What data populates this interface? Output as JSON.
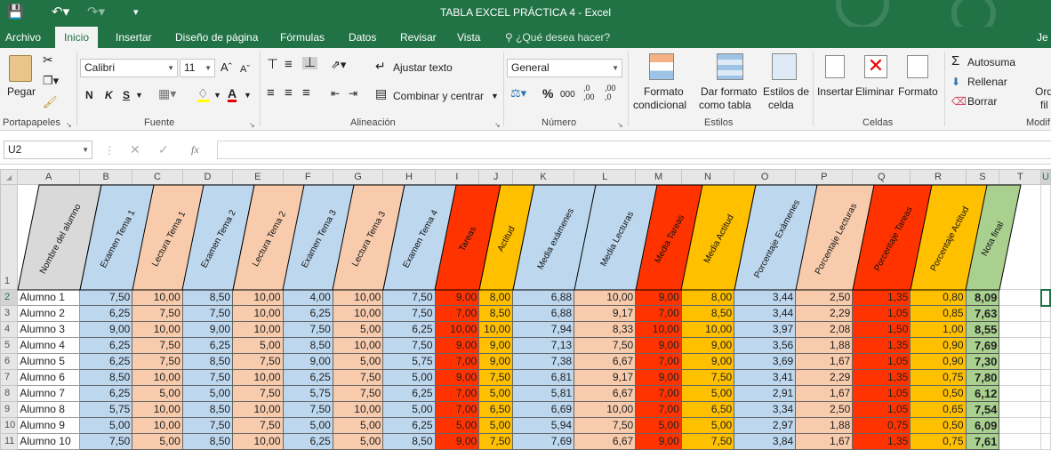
{
  "window": {
    "title": "TABLA EXCEL PRÁCTICA 4 - Excel",
    "user": "Je"
  },
  "tabs": [
    "Archivo",
    "Inicio",
    "Insertar",
    "Diseño de página",
    "Fórmulas",
    "Datos",
    "Revisar",
    "Vista"
  ],
  "tell_me": "¿Qué desea hacer?",
  "ribbon": {
    "clipboard": {
      "paste": "Pegar",
      "group": "Portapapeles"
    },
    "font": {
      "name": "Calibri",
      "size": "11",
      "bold": "N",
      "italic": "K",
      "underline": "S",
      "group": "Fuente"
    },
    "alignment": {
      "wrap": "Ajustar texto",
      "merge": "Combinar y centrar",
      "group": "Alineación"
    },
    "number": {
      "format": "General",
      "percent": "%",
      "thousands": "000",
      "inc_dec": ",0 ,00",
      "dec_dec": ",00 ,0",
      "group": "Número"
    },
    "styles": {
      "cond_1": "Formato",
      "cond_2": "condicional",
      "table_1": "Dar formato",
      "table_2": "como tabla",
      "cell_1": "Estilos de",
      "cell_2": "celda",
      "group": "Estilos"
    },
    "cells": {
      "insert": "Insertar",
      "delete": "Eliminar",
      "format": "Formato",
      "group": "Celdas"
    },
    "editing": {
      "autosum": "Autosuma",
      "fill": "Rellenar",
      "clear": "Borrar",
      "sort_1": "Ord",
      "sort_2": "fil",
      "group": "Modif"
    }
  },
  "formula_bar": {
    "name_box": "U2",
    "fx": "fx",
    "value": ""
  },
  "sheet": {
    "columns": [
      "A",
      "B",
      "C",
      "D",
      "E",
      "F",
      "G",
      "H",
      "I",
      "J",
      "K",
      "L",
      "M",
      "N",
      "O",
      "P",
      "Q",
      "R",
      "S",
      "T"
    ],
    "selected_column": "U",
    "selected_row": "2",
    "headers": [
      "Nombre del alumno",
      "Examen Tema 1",
      "Lectura Tema 1",
      "Examen Tema 2",
      "Lectura Tema 2",
      "Examen Tema 3",
      "Lectura Tema 3",
      "Examen Tema 4",
      "Tareas",
      "Actitud",
      "Media exámenes",
      "Media Lecturas",
      "Media Tareas",
      "Media Actitud",
      "Porcentaje Exámenes",
      "Porcentaje Lecturas",
      "Porcentaje Tareas",
      "Porcentaje Actitud",
      "Nota final"
    ],
    "header_colors": [
      "#d9d9d9",
      "#bdd7ee",
      "#f8cbad",
      "#bdd7ee",
      "#f8cbad",
      "#bdd7ee",
      "#f8cbad",
      "#bdd7ee",
      "#ff3300",
      "#ffc000",
      "#bdd7ee",
      "#bdd7ee",
      "#ff3300",
      "#ffc000",
      "#bdd7ee",
      "#f8cbad",
      "#ff3300",
      "#ffc000",
      "#a9d08e"
    ],
    "body_colors": [
      "#ffffff",
      "#bdd7ee",
      "#f8cbad",
      "#bdd7ee",
      "#f8cbad",
      "#bdd7ee",
      "#f8cbad",
      "#bdd7ee",
      "#ff3300",
      "#ffc000",
      "#bdd7ee",
      "#f8cbad",
      "#ff3300",
      "#ffc000",
      "#bdd7ee",
      "#f8cbad",
      "#ff3300",
      "#ffc000",
      "#a9d08e"
    ],
    "rows": [
      {
        "n": "2",
        "cells": [
          "Alumno 1",
          "7,50",
          "10,00",
          "8,50",
          "10,00",
          "4,00",
          "10,00",
          "7,50",
          "9,00",
          "8,00",
          "6,88",
          "10,00",
          "9,00",
          "8,00",
          "3,44",
          "2,50",
          "1,35",
          "0,80",
          "8,09"
        ]
      },
      {
        "n": "3",
        "cells": [
          "Alumno 2",
          "6,25",
          "7,50",
          "7,50",
          "10,00",
          "6,25",
          "10,00",
          "7,50",
          "7,00",
          "8,50",
          "6,88",
          "9,17",
          "7,00",
          "8,50",
          "3,44",
          "2,29",
          "1,05",
          "0,85",
          "7,63"
        ]
      },
      {
        "n": "4",
        "cells": [
          "Alumno 3",
          "9,00",
          "10,00",
          "9,00",
          "10,00",
          "7,50",
          "5,00",
          "6,25",
          "10,00",
          "10,00",
          "7,94",
          "8,33",
          "10,00",
          "10,00",
          "3,97",
          "2,08",
          "1,50",
          "1,00",
          "8,55"
        ]
      },
      {
        "n": "5",
        "cells": [
          "Alumno 4",
          "6,25",
          "7,50",
          "6,25",
          "5,00",
          "8,50",
          "10,00",
          "7,50",
          "9,00",
          "9,00",
          "7,13",
          "7,50",
          "9,00",
          "9,00",
          "3,56",
          "1,88",
          "1,35",
          "0,90",
          "7,69"
        ]
      },
      {
        "n": "6",
        "cells": [
          "Alumno 5",
          "6,25",
          "7,50",
          "8,50",
          "7,50",
          "9,00",
          "5,00",
          "5,75",
          "7,00",
          "9,00",
          "7,38",
          "6,67",
          "7,00",
          "9,00",
          "3,69",
          "1,67",
          "1,05",
          "0,90",
          "7,30"
        ]
      },
      {
        "n": "7",
        "cells": [
          "Alumno 6",
          "8,50",
          "10,00",
          "7,50",
          "10,00",
          "6,25",
          "7,50",
          "5,00",
          "9,00",
          "7,50",
          "6,81",
          "9,17",
          "9,00",
          "7,50",
          "3,41",
          "2,29",
          "1,35",
          "0,75",
          "7,80"
        ]
      },
      {
        "n": "8",
        "cells": [
          "Alumno 7",
          "6,25",
          "5,00",
          "5,00",
          "7,50",
          "5,75",
          "7,50",
          "6,25",
          "7,00",
          "5,00",
          "5,81",
          "6,67",
          "7,00",
          "5,00",
          "2,91",
          "1,67",
          "1,05",
          "0,50",
          "6,12"
        ]
      },
      {
        "n": "9",
        "cells": [
          "Alumno 8",
          "5,75",
          "10,00",
          "8,50",
          "10,00",
          "7,50",
          "10,00",
          "5,00",
          "7,00",
          "6,50",
          "6,69",
          "10,00",
          "7,00",
          "6,50",
          "3,34",
          "2,50",
          "1,05",
          "0,65",
          "7,54"
        ]
      },
      {
        "n": "10",
        "cells": [
          "Alumno 9",
          "5,00",
          "10,00",
          "7,50",
          "7,50",
          "5,00",
          "5,00",
          "6,25",
          "5,00",
          "5,00",
          "5,94",
          "7,50",
          "5,00",
          "5,00",
          "2,97",
          "1,88",
          "0,75",
          "0,50",
          "6,09"
        ]
      },
      {
        "n": "11",
        "cells": [
          "Alumno 10",
          "7,50",
          "5,00",
          "8,50",
          "10,00",
          "6,25",
          "5,00",
          "8,50",
          "9,00",
          "7,50",
          "7,69",
          "6,67",
          "9,00",
          "7,50",
          "3,84",
          "1,67",
          "1,35",
          "0,75",
          "7,61"
        ]
      }
    ]
  }
}
